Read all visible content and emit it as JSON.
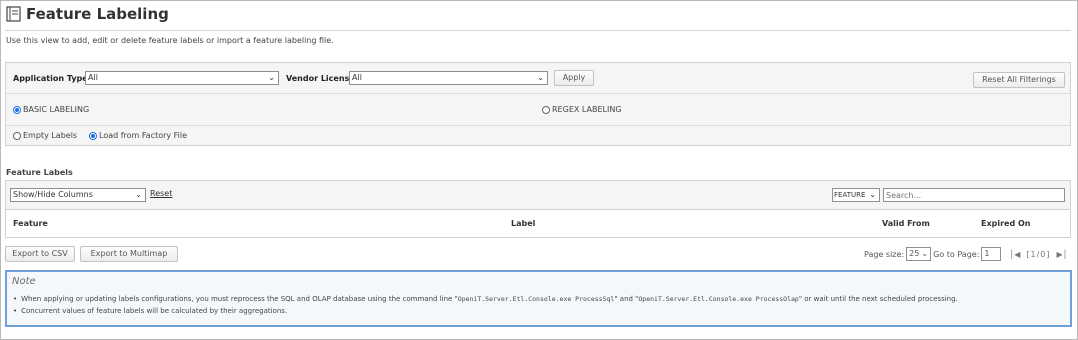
{
  "header": {
    "title": "Feature Labeling",
    "description": "Use this view to add, edit or delete feature labels or import a feature labeling file."
  },
  "filters": {
    "application_type_label": "Application Type:",
    "application_type_value": "All",
    "vendor_license_label": "Vendor License:",
    "vendor_license_value": "All",
    "apply_label": "Apply",
    "reset_all_label": "Reset All Filterings"
  },
  "labeling_modes": {
    "basic": "BASIC LABELING",
    "regex": "REGEX LABELING",
    "selected": "basic"
  },
  "source_options": {
    "empty": "Empty Labels",
    "factory": "Load from Factory File",
    "selected": "factory"
  },
  "grid": {
    "section_title": "Feature Labels",
    "columns_dropdown": "Show/Hide Columns",
    "reset_link": "Reset",
    "search_field_value": "FEATURE",
    "search_placeholder": "Search...",
    "columns": [
      "Feature",
      "Label",
      "Valid From",
      "Expired On"
    ]
  },
  "footer": {
    "export_csv": "Export to CSV",
    "export_multimap": "Export to Multimap",
    "page_size_label": "Page size:",
    "page_size_value": "25",
    "go_to_page_label": "Go to Page:",
    "go_to_page_value": "1",
    "page_indicator": "[1/0]"
  },
  "note": {
    "title": "Note",
    "line1_a": "When applying or updating labels configurations, you must reprocess the SQL and OLAP database using the command line \"",
    "line1_cmd1": "OpeniT.Server.Etl.Console.exe ProcessSql",
    "line1_b": "\" and \"",
    "line1_cmd2": "OpeniT.Server.Etl.Console.exe ProcessOlap",
    "line1_c": "\" or wait until the next scheduled processing.",
    "line2": "Concurrent values of feature labels will be calculated by their aggregations."
  },
  "colors": {
    "accent": "#1a73e8",
    "note_border": "#6f9fd8",
    "panel_bg": "#f5f5f5"
  }
}
